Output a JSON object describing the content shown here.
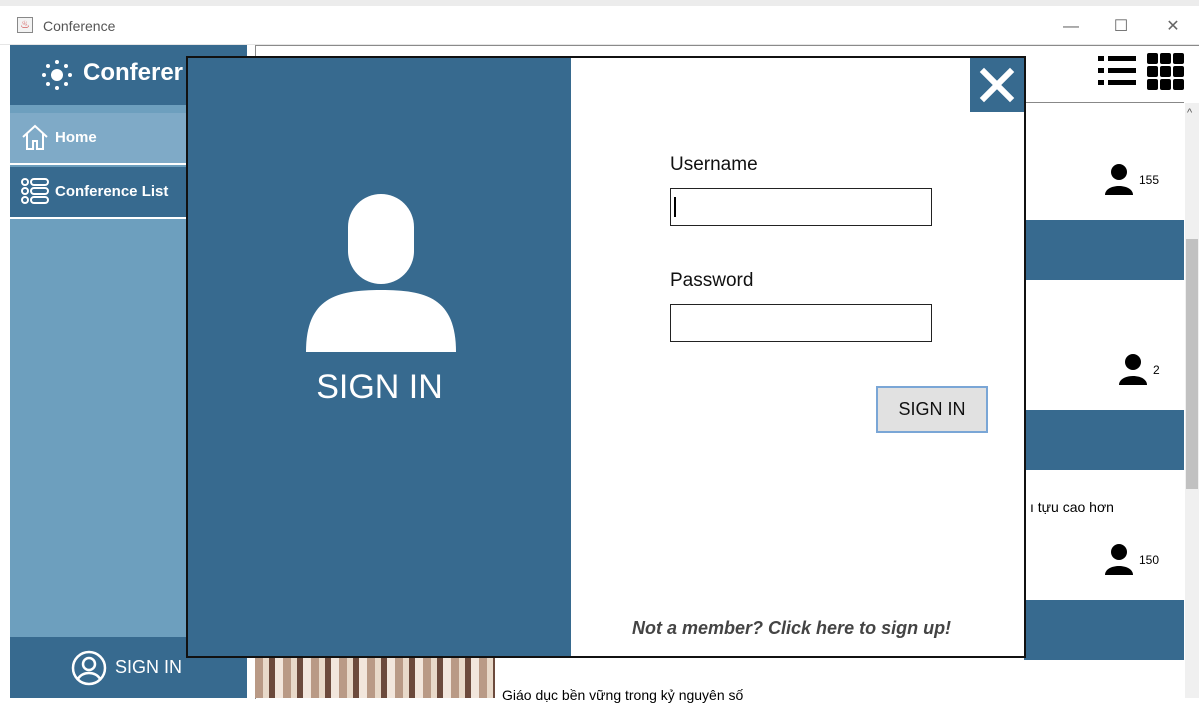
{
  "window": {
    "title": "Conference",
    "minimize": "—",
    "maximize": "☐",
    "close": "✕"
  },
  "sidebar": {
    "logo_text": "Conferer",
    "items": [
      {
        "label": "Home",
        "icon": "home-icon"
      },
      {
        "label": "Conference List",
        "icon": "list-icon"
      }
    ],
    "signin_label": "SIGN IN"
  },
  "cards": [
    {
      "attendees": "155"
    },
    {
      "attendees": "2"
    },
    {
      "attendees": "150",
      "snippet": "ı tựu cao hơn"
    }
  ],
  "bottom_caption": "Giáo dục bền vững trong kỷ nguyên số",
  "modal": {
    "title": "SIGN IN",
    "username_label": "Username",
    "username_value": "",
    "password_label": "Password",
    "password_value": "",
    "submit_label": "SIGN IN",
    "signup_text": "Not a member? Click here to sign up!",
    "close_icon": "close-icon"
  },
  "colors": {
    "primary": "#376a8f",
    "sidebar": "#6d9fbe",
    "nav_active": "#7faac7"
  }
}
